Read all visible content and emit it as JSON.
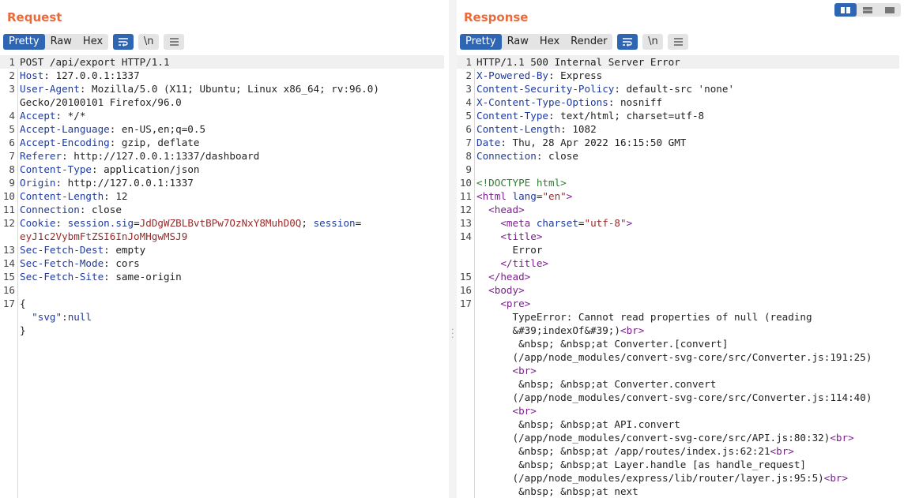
{
  "request": {
    "title": "Request",
    "tabs": [
      "Pretty",
      "Raw",
      "Hex"
    ],
    "active_tab": "Pretty",
    "newline_label": "\\n",
    "lines": [
      {
        "n": "1",
        "segs": [
          {
            "t": "POST /api/export HTTP/1.1"
          }
        ]
      },
      {
        "n": "2",
        "segs": [
          {
            "t": "Host",
            "c": "hk"
          },
          {
            "t": ": 127.0.0.1:1337"
          }
        ]
      },
      {
        "n": "3",
        "segs": [
          {
            "t": "User-Agent",
            "c": "hk"
          },
          {
            "t": ": Mozilla/5.0 (X11; Ubuntu; Linux x86_64; rv:96.0)"
          }
        ]
      },
      {
        "n": "",
        "segs": [
          {
            "t": "Gecko/20100101 Firefox/96.0"
          }
        ]
      },
      {
        "n": "4",
        "segs": [
          {
            "t": "Accept",
            "c": "hk"
          },
          {
            "t": ": */*"
          }
        ]
      },
      {
        "n": "5",
        "segs": [
          {
            "t": "Accept-Language",
            "c": "hk"
          },
          {
            "t": ": en-US,en;q=0.5"
          }
        ]
      },
      {
        "n": "6",
        "segs": [
          {
            "t": "Accept-Encoding",
            "c": "hk"
          },
          {
            "t": ": gzip, deflate"
          }
        ]
      },
      {
        "n": "7",
        "segs": [
          {
            "t": "Referer",
            "c": "hk"
          },
          {
            "t": ": http://127.0.0.1:1337/dashboard"
          }
        ]
      },
      {
        "n": "8",
        "segs": [
          {
            "t": "Content-Type",
            "c": "hk"
          },
          {
            "t": ": application/json"
          }
        ]
      },
      {
        "n": "9",
        "segs": [
          {
            "t": "Origin",
            "c": "hk"
          },
          {
            "t": ": http://127.0.0.1:1337"
          }
        ]
      },
      {
        "n": "10",
        "segs": [
          {
            "t": "Content-Length",
            "c": "hk"
          },
          {
            "t": ": 12"
          }
        ]
      },
      {
        "n": "11",
        "segs": [
          {
            "t": "Connection",
            "c": "hk"
          },
          {
            "t": ": close"
          }
        ]
      },
      {
        "n": "12",
        "segs": [
          {
            "t": "Cookie",
            "c": "hk"
          },
          {
            "t": ": "
          },
          {
            "t": "session.sig",
            "c": "hk"
          },
          {
            "t": "="
          },
          {
            "t": "JdDgWZBLBvtBPw7OzNxY8MuhD0Q",
            "c": "cv"
          },
          {
            "t": "; "
          },
          {
            "t": "session",
            "c": "hk"
          },
          {
            "t": "="
          }
        ]
      },
      {
        "n": "",
        "segs": [
          {
            "t": "eyJ1c2VybmFtZSI6InJoMHgwMSJ9",
            "c": "cv"
          }
        ]
      },
      {
        "n": "13",
        "segs": [
          {
            "t": "Sec-Fetch-Dest",
            "c": "hk"
          },
          {
            "t": ": empty"
          }
        ]
      },
      {
        "n": "14",
        "segs": [
          {
            "t": "Sec-Fetch-Mode",
            "c": "hk"
          },
          {
            "t": ": cors"
          }
        ]
      },
      {
        "n": "15",
        "segs": [
          {
            "t": "Sec-Fetch-Site",
            "c": "hk"
          },
          {
            "t": ": same-origin"
          }
        ]
      },
      {
        "n": "16",
        "segs": [
          {
            "t": ""
          }
        ]
      },
      {
        "n": "17",
        "segs": [
          {
            "t": "{"
          }
        ]
      },
      {
        "n": "",
        "segs": [
          {
            "t": "  "
          },
          {
            "t": "\"svg\"",
            "c": "jk"
          },
          {
            "t": ":"
          },
          {
            "t": "null",
            "c": "jk"
          }
        ]
      },
      {
        "n": "",
        "segs": [
          {
            "t": "}"
          }
        ]
      }
    ]
  },
  "response": {
    "title": "Response",
    "tabs": [
      "Pretty",
      "Raw",
      "Hex",
      "Render"
    ],
    "active_tab": "Pretty",
    "newline_label": "\\n",
    "lines": [
      {
        "n": "1",
        "segs": [
          {
            "t": "HTTP/1.1 500 Internal Server Error"
          }
        ]
      },
      {
        "n": "2",
        "segs": [
          {
            "t": "X-Powered-By",
            "c": "hk"
          },
          {
            "t": ": Express"
          }
        ]
      },
      {
        "n": "3",
        "segs": [
          {
            "t": "Content-Security-Policy",
            "c": "hk"
          },
          {
            "t": ": default-src 'none'"
          }
        ]
      },
      {
        "n": "4",
        "segs": [
          {
            "t": "X-Content-Type-Options",
            "c": "hk"
          },
          {
            "t": ": nosniff"
          }
        ]
      },
      {
        "n": "5",
        "segs": [
          {
            "t": "Content-Type",
            "c": "hk"
          },
          {
            "t": ": text/html; charset=utf-8"
          }
        ]
      },
      {
        "n": "6",
        "segs": [
          {
            "t": "Content-Length",
            "c": "hk"
          },
          {
            "t": ": 1082"
          }
        ]
      },
      {
        "n": "7",
        "segs": [
          {
            "t": "Date",
            "c": "hk"
          },
          {
            "t": ": Thu, 28 Apr 2022 16:15:50 GMT"
          }
        ]
      },
      {
        "n": "8",
        "segs": [
          {
            "t": "Connection",
            "c": "hk"
          },
          {
            "t": ": close"
          }
        ]
      },
      {
        "n": "9",
        "segs": [
          {
            "t": ""
          }
        ]
      },
      {
        "n": "10",
        "segs": [
          {
            "t": "<!DOCTYPE html>",
            "c": "dt"
          }
        ]
      },
      {
        "n": "11",
        "segs": [
          {
            "t": "<html ",
            "c": "tag"
          },
          {
            "t": "lang",
            "c": "attr"
          },
          {
            "t": "="
          },
          {
            "t": "\"en\"",
            "c": "str"
          },
          {
            "t": ">",
            "c": "tag"
          }
        ]
      },
      {
        "n": "12",
        "segs": [
          {
            "t": "  "
          },
          {
            "t": "<head>",
            "c": "tag"
          }
        ]
      },
      {
        "n": "13",
        "segs": [
          {
            "t": "    "
          },
          {
            "t": "<meta ",
            "c": "tag"
          },
          {
            "t": "charset",
            "c": "attr"
          },
          {
            "t": "="
          },
          {
            "t": "\"utf-8\"",
            "c": "str"
          },
          {
            "t": ">",
            "c": "tag"
          }
        ]
      },
      {
        "n": "14",
        "segs": [
          {
            "t": "    "
          },
          {
            "t": "<title>",
            "c": "tag"
          }
        ]
      },
      {
        "n": "",
        "segs": [
          {
            "t": "      Error"
          }
        ]
      },
      {
        "n": "",
        "segs": [
          {
            "t": "    "
          },
          {
            "t": "</title>",
            "c": "tag"
          }
        ]
      },
      {
        "n": "15",
        "segs": [
          {
            "t": "  "
          },
          {
            "t": "</head>",
            "c": "tag"
          }
        ]
      },
      {
        "n": "16",
        "segs": [
          {
            "t": "  "
          },
          {
            "t": "<body>",
            "c": "tag"
          }
        ]
      },
      {
        "n": "17",
        "segs": [
          {
            "t": "    "
          },
          {
            "t": "<pre>",
            "c": "tag"
          }
        ]
      },
      {
        "n": "",
        "segs": [
          {
            "t": "      TypeError: Cannot read properties of null (reading"
          }
        ]
      },
      {
        "n": "",
        "segs": [
          {
            "t": "      &#39;indexOf&#39;)"
          },
          {
            "t": "<br>",
            "c": "tag"
          }
        ]
      },
      {
        "n": "",
        "segs": [
          {
            "t": "       &nbsp; &nbsp;at Converter.[convert]"
          }
        ]
      },
      {
        "n": "",
        "segs": [
          {
            "t": "      (/app/node_modules/convert-svg-core/src/Converter.js:191:25)"
          }
        ]
      },
      {
        "n": "",
        "segs": [
          {
            "t": "      "
          },
          {
            "t": "<br>",
            "c": "tag"
          }
        ]
      },
      {
        "n": "",
        "segs": [
          {
            "t": "       &nbsp; &nbsp;at Converter.convert"
          }
        ]
      },
      {
        "n": "",
        "segs": [
          {
            "t": "      (/app/node_modules/convert-svg-core/src/Converter.js:114:40)"
          }
        ]
      },
      {
        "n": "",
        "segs": [
          {
            "t": "      "
          },
          {
            "t": "<br>",
            "c": "tag"
          }
        ]
      },
      {
        "n": "",
        "segs": [
          {
            "t": "       &nbsp; &nbsp;at API.convert"
          }
        ]
      },
      {
        "n": "",
        "segs": [
          {
            "t": "      (/app/node_modules/convert-svg-core/src/API.js:80:32)"
          },
          {
            "t": "<br>",
            "c": "tag"
          }
        ]
      },
      {
        "n": "",
        "segs": [
          {
            "t": "       &nbsp; &nbsp;at /app/routes/index.js:62:21"
          },
          {
            "t": "<br>",
            "c": "tag"
          }
        ]
      },
      {
        "n": "",
        "segs": [
          {
            "t": "       &nbsp; &nbsp;at Layer.handle [as handle_request]"
          }
        ]
      },
      {
        "n": "",
        "segs": [
          {
            "t": "      (/app/node_modules/express/lib/router/layer.js:95:5)"
          },
          {
            "t": "<br>",
            "c": "tag"
          }
        ]
      },
      {
        "n": "",
        "segs": [
          {
            "t": "       &nbsp; &nbsp;at next"
          }
        ]
      }
    ]
  },
  "colors": {
    "accent": "#2f66b3",
    "title": "#ec6a3a",
    "header_key": "#1e3a9e",
    "value_red": "#9b2929",
    "tag": "#7a1f8c",
    "doctype": "#2e7d32"
  },
  "icons": {
    "wrap": "word-wrap-icon",
    "newline": "newline-icon",
    "menu": "hamburger-menu-icon",
    "layouts": [
      "side-by-side-icon",
      "horizontal-split-icon",
      "single-pane-icon"
    ]
  }
}
